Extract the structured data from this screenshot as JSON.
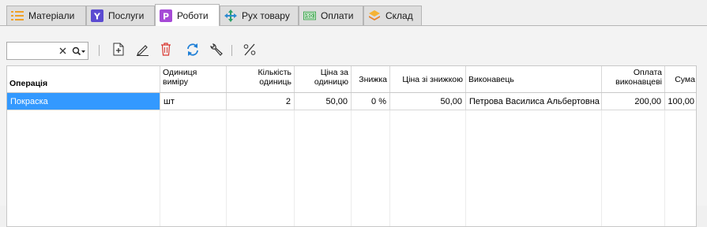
{
  "tabs": [
    {
      "label": "Матеріали",
      "icon": "list-icon"
    },
    {
      "label": "Послуги",
      "icon": "services-icon"
    },
    {
      "label": "Роботи",
      "icon": "works-icon",
      "active": true
    },
    {
      "label": "Рух товару",
      "icon": "move-arrows-icon"
    },
    {
      "label": "Оплати",
      "icon": "payment-icon"
    },
    {
      "label": "Склад",
      "icon": "warehouse-layers-icon"
    }
  ],
  "colors": {
    "selection": "#3399ff",
    "services_icon": "#5b4bd1",
    "works_icon": "#a64ad6",
    "payment_icon": "#2e9e3e",
    "delete_icon": "#d9362f",
    "refresh_icon": "#1e7fd6",
    "list_icon": "#f0a024",
    "warehouse_icon": "#f08c1e"
  },
  "search": {
    "value": "",
    "placeholder": ""
  },
  "toolbar": {
    "buttons": [
      "add-icon",
      "edit-pencil-icon",
      "delete-trash-icon",
      "refresh-icon",
      "settings-wrench-icon",
      "percent-icon"
    ]
  },
  "grid": {
    "columns": [
      "Операція",
      "Одиниця виміру",
      "Кількість одиниць",
      "Ціна за одиницю",
      "Знижка",
      "Ціна зі знижкою",
      "Виконавець",
      "Оплата виконавцеві",
      "Сума"
    ],
    "rows": [
      [
        "Покраска",
        "шт",
        "2",
        "50,00",
        "0 %",
        "50,00",
        "Петрова Василиса Альбертовна",
        "200,00",
        "100,00"
      ]
    ]
  }
}
